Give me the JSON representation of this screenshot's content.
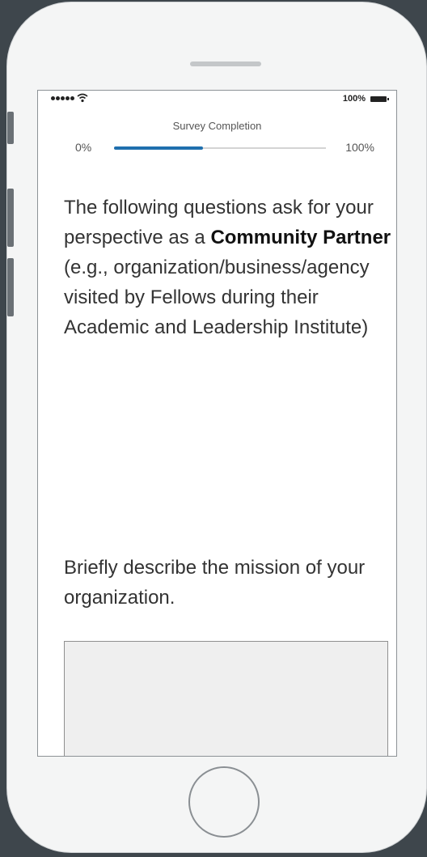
{
  "status_bar": {
    "battery_text": "100%",
    "icons": [
      "signal-dots-icon",
      "wifi-icon",
      "battery-icon"
    ]
  },
  "survey_progress": {
    "title": "Survey Completion",
    "min_label": "0%",
    "max_label": "100%",
    "value_fraction": 0.42,
    "fill_color": "#1f6fae"
  },
  "intro": {
    "line_start": "The following questions ask for your perspective as a ",
    "role": "Community Partner",
    "line_end": " (e.g., organization/business/agency visited by Fellows during their Academic and Leadership Institute)"
  },
  "question": {
    "text": "Briefly describe the mission of your organization.",
    "answer_value": ""
  }
}
